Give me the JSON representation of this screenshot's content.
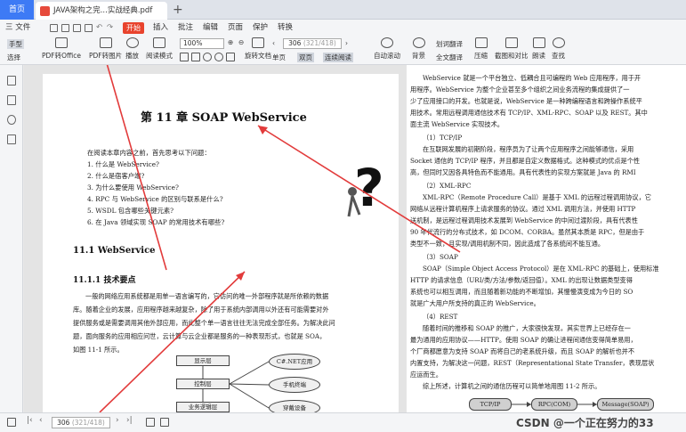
{
  "tabs": {
    "home": "首页",
    "doc": "JAVA架构之完...实战经典.pdf"
  },
  "menu": {
    "file": "三 文件",
    "start": "开始",
    "insert": "插入",
    "comment": "批注",
    "edit": "编辑",
    "page": "页面",
    "protect": "保护",
    "convert": "转换"
  },
  "toolbar": {
    "hand": "手型",
    "select": "选择",
    "pdf_to_office": "PDF转Office",
    "pdf_to_image": "PDF转图片",
    "play": "播放",
    "read_mode": "阅读模式",
    "zoom_value": "100%",
    "rotate": "旋转文档",
    "single": "单页",
    "double": "双页",
    "continuous": "连续阅读",
    "auto_scroll": "自动滚动",
    "background": "背景",
    "translate_word": "划词翻译",
    "translate_full": "全文翻译",
    "compress": "压缩",
    "screenshot_compare": "截图和对比",
    "read_aloud": "朗读",
    "find": "查找",
    "page_current": "306",
    "page_total": "(321/418)"
  },
  "left_page": {
    "chapter_title": "第 11 章   SOAP WebService",
    "intro": "在阅读本章内容之前，首先思考以下问题：",
    "questions": [
      "1. 什么是 WebService?",
      "2. 什么是宿客户端?",
      "3. 为什么要使用 WebService?",
      "4. RPC 与 WebService 的区别与联系是什么?",
      "5. WSDL 包含哪些关键元素?",
      "6. 在 Java 领域实现 SOAP 的常用技术有哪些?"
    ],
    "section_11_1": "11.1   WebService",
    "section_11_1_1": "11.1.1   技术要点",
    "paragraph": [
      "一般的网络应用系统都是用单一语言编写的，它访问的唯一外部程序就是所依赖的数据",
      "库。随着企业的发展，应用程序越来越复杂，除了用于系统内部调用以外还有可能需要对外",
      "提供服务或是需要调用其他外部应用，而此整个单一语言往往无法完成全部任务。为解决此问",
      "题，面向服务的应用相应问世，云计算与云企业都是服务的一种表现形式，也就是 SOA，",
      "如图 11-1 所示。"
    ],
    "diagram": {
      "top": "显示层",
      "middle": "控制层",
      "bottom": "业务逻辑层",
      "e1": "C#.NET应用",
      "e2": "手机终端",
      "e3": "穿戴设备"
    }
  },
  "right_page": {
    "lines": [
      "WebService 就是一个平台独立、低耦合且可编程的 Web 应用程序，用于开",
      "用程序。WebService 为整个企业甚至多个组织之间业务流程的集成提供了一",
      "少了应用接口的开发。也就是说，WebService 是一种跨编程语言和跨操作系统平",
      "用技术。常用远程调用通信技术有 TCP/IP、XML-RPC、SOAP 以及 REST。其中",
      "面主流 WebService 实现技术。",
      "（1）TCP/IP",
      "在互联网发展的初期阶段，程序员为了让两个应用程序之间能够通信，采用",
      "Socket 通信的 TCP/IP 程序，并且都是自定义数据格式。这种模式的优点是个性",
      "高，但同时又因各具特色而不能通用。具有代表性的实现方案就是 Java 的 RMI",
      "（2）XML-RPC",
      "XML-RPC（Remote Procedure Call）是基于 XML 的远程过程调用协议，它",
      "网络从远程计算机程序上请求服务的协议。通过 XML 调用方法，并使用 HTTP",
      "送机制，是远程过程调用技术发展到 WebService 的中间过渡阶段，具有代表性",
      "90 年代流行的分布式技术，如 DCOM、CORBA。虽然其本质是 RPC，但是由于",
      "类型不一致，且实现/调用机制不同，因此造成了各系统间不能互通。",
      "（3）SOAP",
      "SOAP（Simple Object Access Protocol）是在 XML-RPC 的基础上，使用标准",
      "HTTP 的请求信息（URI/类/方法/参数/返回值）。XML 的出现让数据类型变得",
      "系统也可以相互调用，而且随着新功能的不断增加，其慢慢演变成为今日的 SO",
      "就是广大用户所支持的真正的 WebService。",
      "（4）REST",
      "随着时间的推移和 SOAP 的推广，大家很快发现，其实世界上已经存在一",
      "最为通用的应用协议——HTTP。使用 SOAP 的确让进程间通信变得简单易用，",
      "个厂商都愿意为支持 SOAP 而将自己的老系统升级，而且 SOAP 的解析也并不",
      "内置支持，为解决这一问题，REST（Representational State Transfer，表现层状",
      "应运而生。",
      "综上所述，计算机之间的通信历程可以简单地用图 11-2 所示。"
    ],
    "flow": {
      "f1": "TCP/IP",
      "f2": "RPC(COM)",
      "f3": "Message(SOAP)"
    }
  },
  "status": {
    "page_current": "306",
    "page_total": "(321/418)",
    "watermark": "CSDN @一个正在努力的33"
  }
}
